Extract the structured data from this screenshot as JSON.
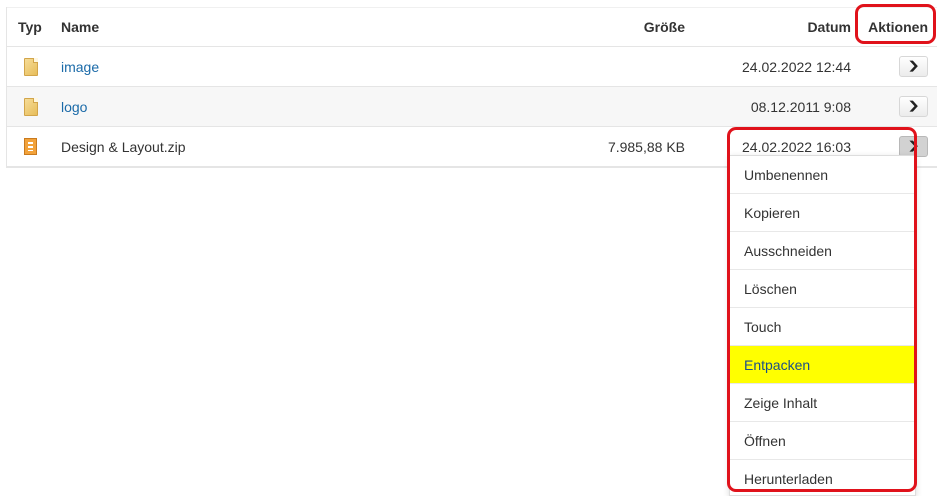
{
  "header": {
    "typ": "Typ",
    "name": "Name",
    "size": "Größe",
    "date": "Datum",
    "actions": "Aktionen"
  },
  "files": [
    {
      "name": "image",
      "size": "",
      "date": "24.02.2022 12:44",
      "icon": "folder-icon"
    },
    {
      "name": "logo",
      "size": "",
      "date": "08.12.2011 9:08",
      "icon": "folder-icon"
    },
    {
      "name": "Design & Layout.zip",
      "size": "7.985,88 KB",
      "date": "24.02.2022 16:03",
      "icon": "zip-file-icon"
    }
  ],
  "menu": {
    "items": [
      "Umbenennen",
      "Kopieren",
      "Ausschneiden",
      "Löschen",
      "Touch",
      "Entpacken",
      "Zeige Inhalt",
      "Öffnen",
      "Herunterladen"
    ],
    "highlighted": "Entpacken"
  },
  "colors": {
    "link": "#1a6aa8",
    "highlight": "#ffff00",
    "annotation": "#e0121b"
  }
}
